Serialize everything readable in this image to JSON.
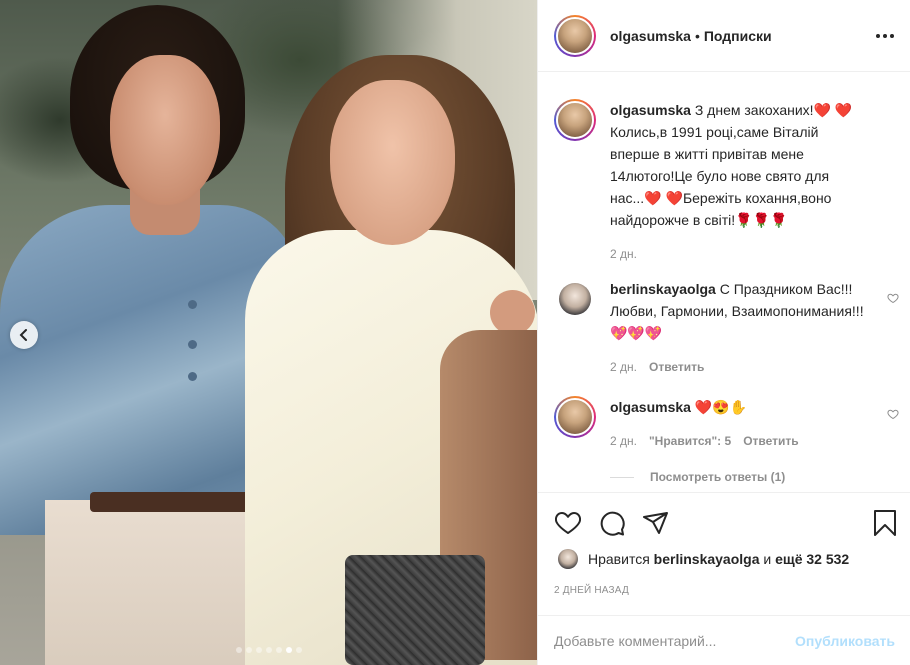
{
  "header": {
    "username": "olgasumska",
    "separator": "•",
    "follow_state": "Подписки",
    "more_icon": "more-horizontal-icon"
  },
  "caption": {
    "username": "olgasumska",
    "text": "З днем закоханих!❤️ ❤️ Колись,в 1991 році,саме Віталій вперше в житті привітав мене 14лютого!Це було нове свято для нас...❤️ ❤️Бережіть кохання,воно найдорожче в світі!🌹🌹🌹",
    "time": "2 дн."
  },
  "comments": [
    {
      "username": "berlinskayaolga",
      "text": "С Праздником Вас!!! Любви, Гармонии, Взаимопонимания!!! 💖💖💖",
      "time": "2 дн.",
      "reply_label": "Ответить"
    },
    {
      "username": "olgasumska",
      "text": "❤️😍✋",
      "time": "2 дн.",
      "likes_label": "\"Нравится\": 5",
      "reply_label": "Ответить",
      "view_replies": "Посмотреть ответы (1)"
    }
  ],
  "actions": {
    "like_icon": "heart-icon",
    "comment_icon": "comment-icon",
    "share_icon": "share-icon",
    "save_icon": "bookmark-icon"
  },
  "likes": {
    "prefix": "Нравится",
    "user": "berlinskayaolga",
    "middle": "и",
    "others": "ещё 32 532"
  },
  "post_time": "2 ДНЕЙ НАЗАД",
  "comment_box": {
    "placeholder": "Добавьте комментарий...",
    "publish_label": "Опубликовать"
  },
  "carousel": {
    "slide_count": 7,
    "active_index": 5
  }
}
